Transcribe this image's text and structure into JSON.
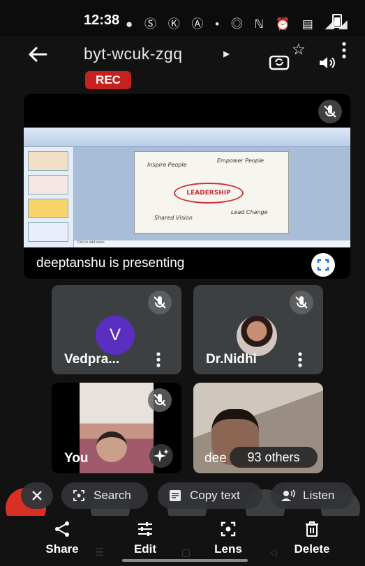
{
  "status_bar": {
    "time": "12:38",
    "icons": [
      "wifi-icon",
      "whatsapp-icon",
      "k-app-icon",
      "a-app-icon",
      "dot-icon",
      "hotspot-icon",
      "nfc-icon",
      "alarm-icon",
      "volte-icon",
      "signal-4g-icon",
      "battery-icon"
    ],
    "icon_glyphs": "● Ⓢ Ⓚ Ⓐ • ◎ ℕ ⏰ ▤ ◢◢"
  },
  "header": {
    "meeting_code": "byt-wcuk-zgq",
    "rec_label": "REC"
  },
  "presentation": {
    "slide_labels": {
      "inspire": "Inspire People",
      "empower": "Empower People",
      "leadership": "LEADERSHIP",
      "vision": "Shared Vision",
      "change": "Lead Change"
    },
    "notes_placeholder": "Click to add notes",
    "presenting_text": "deeptanshu is presenting"
  },
  "participants": [
    {
      "name": "Vedpra...",
      "avatar_letter": "V",
      "avatar_color": "#5b2ec2"
    },
    {
      "name": "Dr.Nidhi"
    }
  ],
  "video_tiles": {
    "you_label": "You",
    "other_label": "dee",
    "others_count": "93 others"
  },
  "lens_chips": {
    "search": "Search",
    "copy_text": "Copy text",
    "listen": "Listen"
  },
  "actions": {
    "share": "Share",
    "edit": "Edit",
    "lens": "Lens",
    "delete": "Delete"
  },
  "colors": {
    "background": "#121212",
    "tile": "#3c4043",
    "rec": "#c5221f",
    "end_call": "#d93025"
  }
}
